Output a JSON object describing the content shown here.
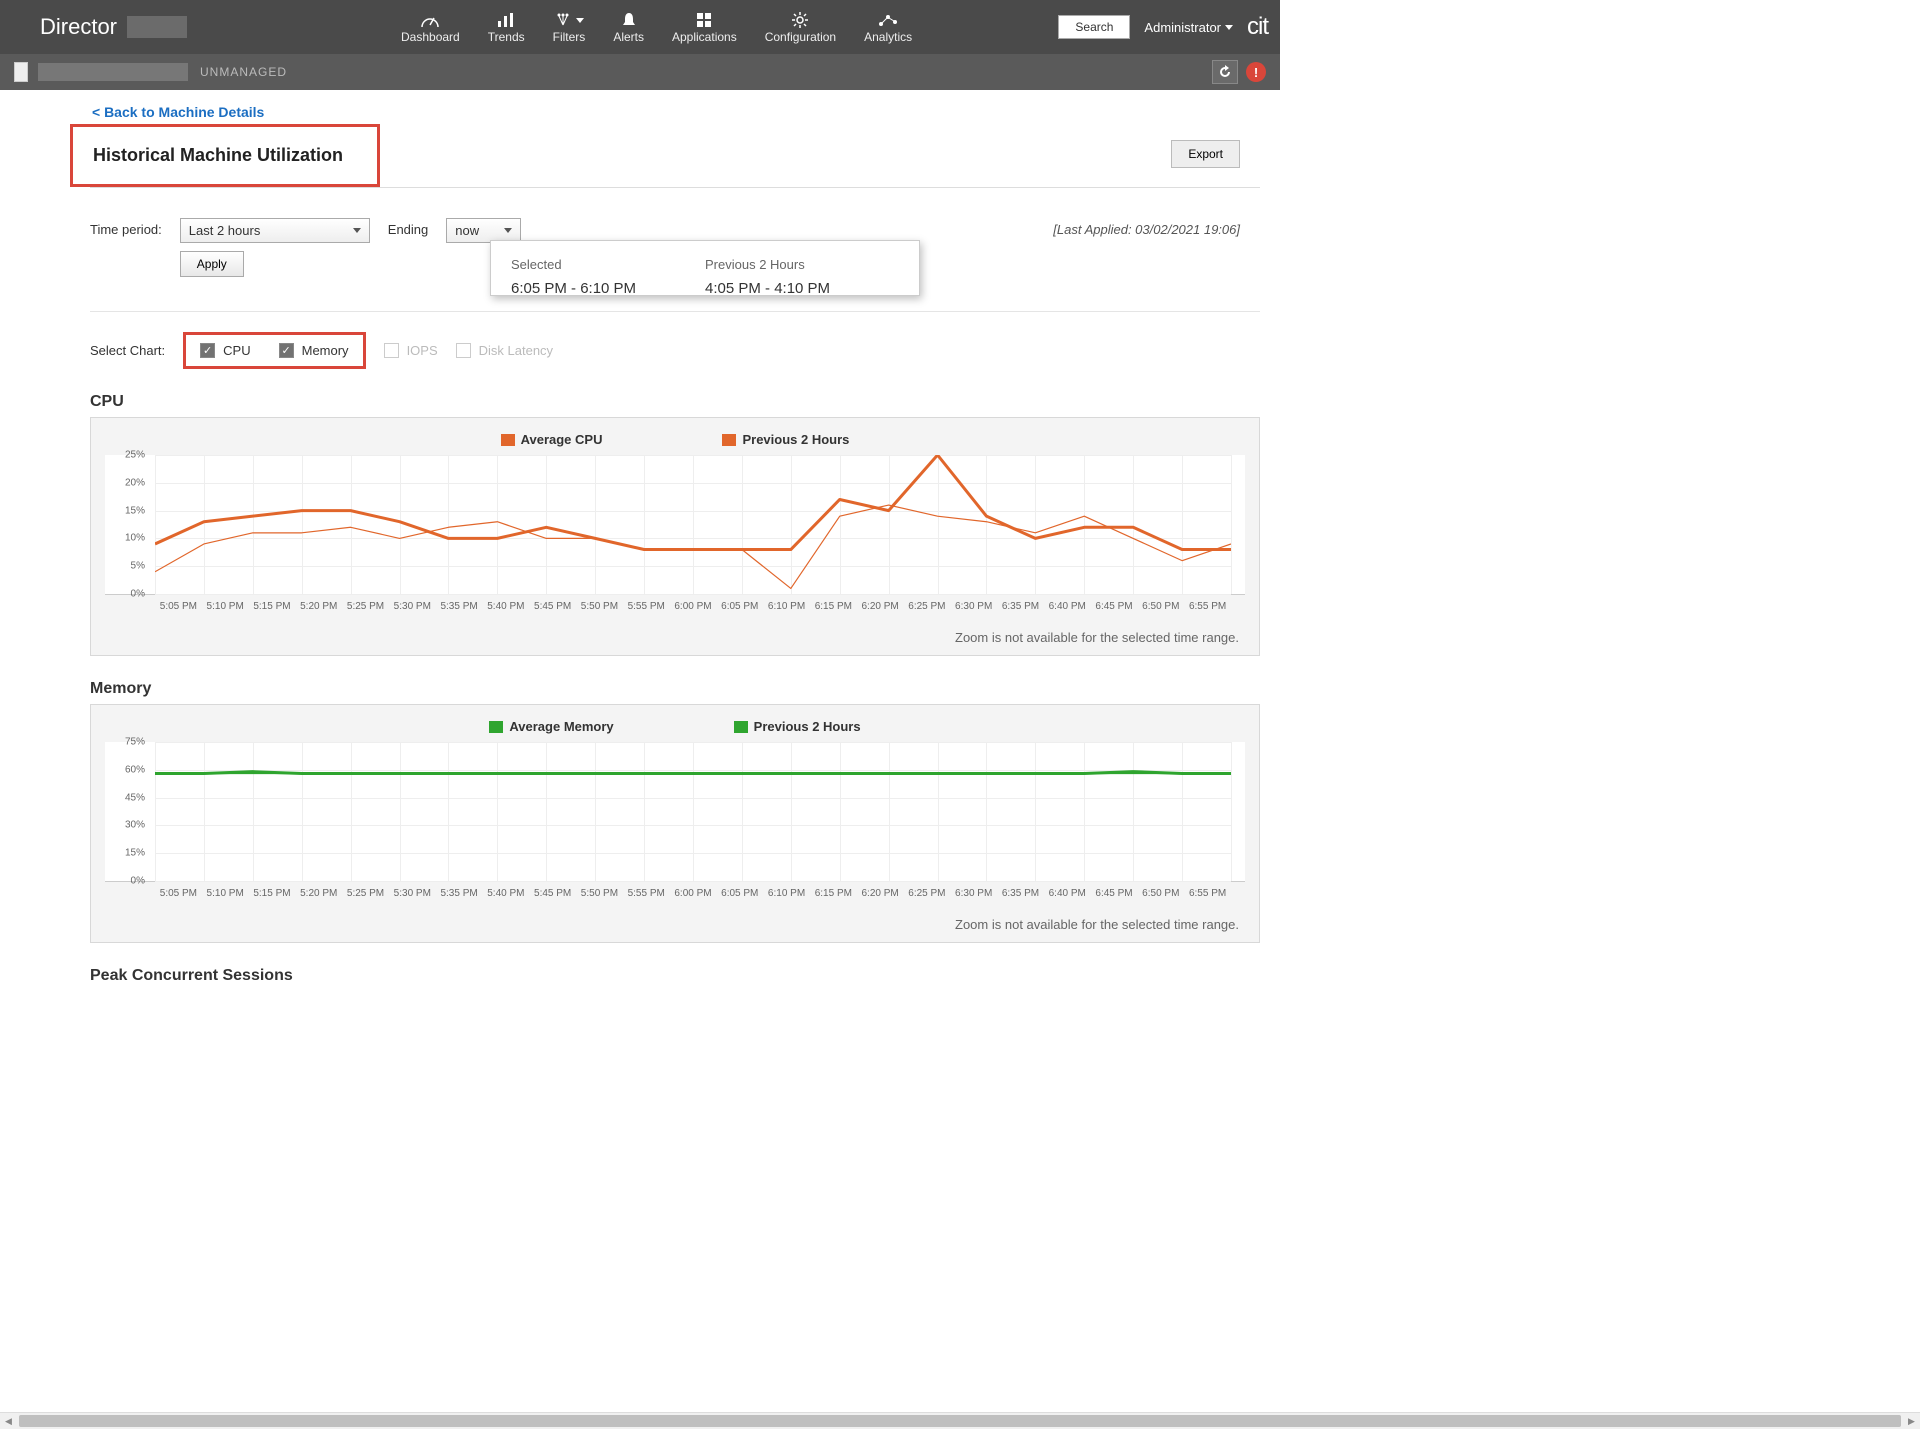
{
  "brand": "Director",
  "nav": {
    "items": [
      "Dashboard",
      "Trends",
      "Filters",
      "Alerts",
      "Applications",
      "Configuration",
      "Analytics"
    ],
    "search": "Search",
    "admin": "Administrator",
    "logo": "cit"
  },
  "subbar": {
    "status": "UNMANAGED",
    "alert": "!"
  },
  "back_link": "< Back to Machine Details",
  "page_title": "Historical Machine Utilization",
  "export_btn": "Export",
  "filters": {
    "time_period_label": "Time period:",
    "time_period_value": "Last 2 hours",
    "ending_label": "Ending",
    "ending_value": "now",
    "apply": "Apply",
    "last_applied": "[Last Applied: 03/02/2021 19:06]"
  },
  "popover": {
    "selected_head": "Selected",
    "selected_val": "6:05 PM - 6:10 PM",
    "prev_head": "Previous 2 Hours",
    "prev_val": "4:05 PM - 4:10 PM"
  },
  "select_chart": {
    "label": "Select Chart:",
    "cpu": "CPU",
    "memory": "Memory",
    "iops": "IOPS",
    "latency": "Disk Latency"
  },
  "zoom_note": "Zoom is not available for the selected time range.",
  "chart_data": [
    {
      "type": "line",
      "title": "CPU",
      "ylabel": "",
      "ylim": [
        0,
        25
      ],
      "yticks": [
        "0%",
        "5%",
        "10%",
        "15%",
        "20%",
        "25%"
      ],
      "x": [
        "5:05 PM",
        "5:10 PM",
        "5:15 PM",
        "5:20 PM",
        "5:25 PM",
        "5:30 PM",
        "5:35 PM",
        "5:40 PM",
        "5:45 PM",
        "5:50 PM",
        "5:55 PM",
        "6:00 PM",
        "6:05 PM",
        "6:10 PM",
        "6:15 PM",
        "6:20 PM",
        "6:25 PM",
        "6:30 PM",
        "6:35 PM",
        "6:40 PM",
        "6:45 PM",
        "6:50 PM",
        "6:55 PM"
      ],
      "series": [
        {
          "name": "Average CPU",
          "color": "#e1662b",
          "width": 3,
          "values": [
            9,
            13,
            14,
            15,
            15,
            13,
            10,
            10,
            12,
            10,
            8,
            8,
            8,
            8,
            17,
            15,
            25,
            14,
            10,
            12,
            12,
            8,
            8
          ]
        },
        {
          "name": "Previous 2 Hours",
          "color": "#e1662b",
          "width": 1.2,
          "values": [
            4,
            9,
            11,
            11,
            12,
            10,
            12,
            13,
            10,
            10,
            8,
            8,
            8,
            1,
            14,
            16,
            14,
            13,
            11,
            14,
            10,
            6,
            9
          ]
        }
      ]
    },
    {
      "type": "line",
      "title": "Memory",
      "ylabel": "",
      "ylim": [
        0,
        75
      ],
      "yticks": [
        "0%",
        "15%",
        "30%",
        "45%",
        "60%",
        "75%"
      ],
      "x": [
        "5:05 PM",
        "5:10 PM",
        "5:15 PM",
        "5:20 PM",
        "5:25 PM",
        "5:30 PM",
        "5:35 PM",
        "5:40 PM",
        "5:45 PM",
        "5:50 PM",
        "5:55 PM",
        "6:00 PM",
        "6:05 PM",
        "6:10 PM",
        "6:15 PM",
        "6:20 PM",
        "6:25 PM",
        "6:30 PM",
        "6:35 PM",
        "6:40 PM",
        "6:45 PM",
        "6:50 PM",
        "6:55 PM"
      ],
      "series": [
        {
          "name": "Average Memory",
          "color": "#2fa52f",
          "width": 3,
          "values": [
            58,
            58,
            59,
            58,
            58,
            58,
            58,
            58,
            58,
            58,
            58,
            58,
            58,
            58,
            58,
            58,
            58,
            58,
            58,
            58,
            59,
            58,
            58
          ]
        },
        {
          "name": "Previous 2 Hours",
          "color": "#2fa52f",
          "width": 1.2,
          "values": [
            58,
            58,
            58,
            58,
            58,
            58,
            58,
            58,
            58,
            58,
            58,
            58,
            58,
            58,
            58,
            58,
            58,
            58,
            58,
            58,
            58,
            58,
            58
          ]
        }
      ]
    }
  ],
  "sessions_title": "Peak Concurrent Sessions"
}
